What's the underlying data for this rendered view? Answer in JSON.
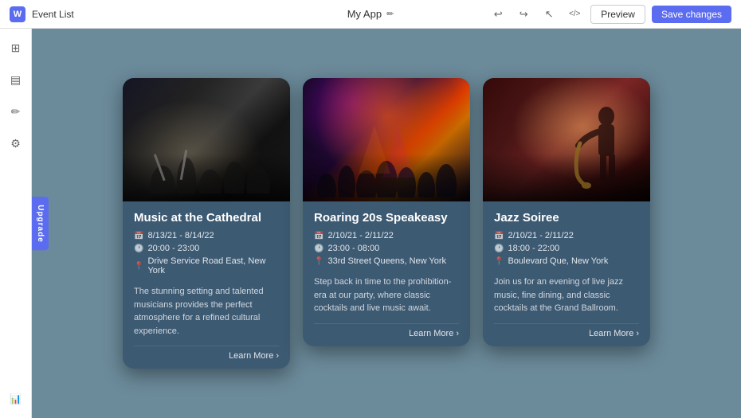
{
  "topbar": {
    "logo_label": "W",
    "page_title": "Event List",
    "app_name": "My App",
    "edit_icon": "✏",
    "preview_label": "Preview",
    "save_label": "Save changes",
    "icons": {
      "undo": "↩",
      "redo": "↪",
      "cursor": "↖",
      "code": "</>",
      "share": "⬆"
    }
  },
  "sidebar": {
    "icons": [
      {
        "name": "grid-icon",
        "symbol": "⊞"
      },
      {
        "name": "layout-icon",
        "symbol": "▤"
      },
      {
        "name": "pen-icon",
        "symbol": "✏"
      },
      {
        "name": "settings-icon",
        "symbol": "⚙"
      },
      {
        "name": "chart-icon",
        "symbol": "📊"
      }
    ]
  },
  "upgrade": {
    "label": "Upgrade"
  },
  "events": [
    {
      "id": "event-1",
      "title": "Music at the Cathedral",
      "date": "8/13/21 - 8/14/22",
      "time": "20:00 - 23:00",
      "location": "Drive Service Road East, New York",
      "description": "The stunning setting and talented musicians provides the perfect atmosphere for a refined cultural experience.",
      "learn_more": "Learn More",
      "image_type": "orchestra"
    },
    {
      "id": "event-2",
      "title": "Roaring 20s Speakeasy",
      "date": "2/10/21 - 2/11/22",
      "time": "23:00 - 08:00",
      "location": "33rd Street Queens, New York",
      "description": "Step back in time to the prohibition-era at our party, where classic cocktails and live music await.",
      "learn_more": "Learn More",
      "image_type": "concert"
    },
    {
      "id": "event-3",
      "title": "Jazz Soiree",
      "date": "2/10/21 - 2/11/22",
      "time": "18:00 - 22:00",
      "location": "Boulevard Que, New York",
      "description": "Join us for an evening of live jazz music, fine dining, and classic cocktails at the Grand Ballroom.",
      "learn_more": "Learn More",
      "image_type": "jazz"
    }
  ]
}
